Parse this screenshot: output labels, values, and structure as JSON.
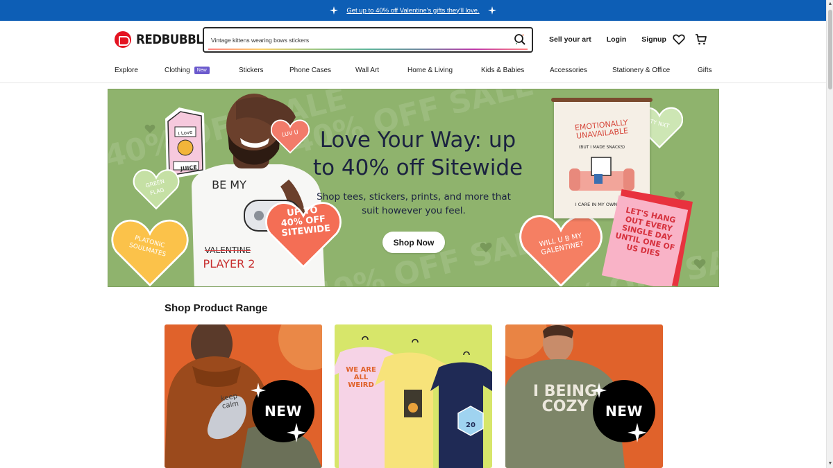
{
  "promo": {
    "text": "Get up to 40% off Valentine's gifts they'll love."
  },
  "header": {
    "brand": "REDBUBBLE",
    "search_value": "Vintage kittens wearing bows stickers",
    "links": [
      "Sell your art",
      "Login",
      "Signup"
    ],
    "icons": [
      "search-icon",
      "heart-icon",
      "cart-icon"
    ]
  },
  "nav": {
    "items": [
      "Explore",
      "Clothing",
      "Stickers",
      "Phone Cases",
      "Wall Art",
      "Home & Living",
      "Kids & Babies",
      "Accessories",
      "Stationery & Office",
      "Gifts"
    ],
    "clothing_badge": "New"
  },
  "hero": {
    "headline": "Love Your Way: up to 40% off Sitewide",
    "subtext": "Shop tees, stickers, prints, and more that suit however you feel.",
    "cta": "Shop Now",
    "background_color": "#8fb36d",
    "art": {
      "sale_text": "40% OFF SALE",
      "juice_label": "JUICE",
      "juice_top": "I Love",
      "shirt_text": "BE MY",
      "shirt_valentine": "VALENTINE",
      "shirt_player": "PLAYER 2",
      "heart_luv": "LUV U",
      "heart_green_flag": "GREEN FLAG",
      "heart_platonic": "PLATONIC SOULMATES",
      "heart_sale": "UP TO 40% OFF SITEWIDE",
      "heart_will": "WILL U B MY GALENTINE?",
      "heart_ty": "TY NXT",
      "poster_title": "EMOTIONALLY UNAVAILABLE",
      "poster_sub": "(BUT I MADE SNACKS)",
      "poster_footer": "I CARE IN MY OWN WAY",
      "card_text": "LET'S HANG OUT EVERY SINGLE DAY UNTIL ONE OF US DIES"
    }
  },
  "section": {
    "title": "Shop Product Range",
    "cards": [
      {
        "name": "hoodie",
        "art_text": "keep calm",
        "badge": "NEW",
        "bg": "#e0622b"
      },
      {
        "name": "tshirts",
        "art_text": "WE ARE ALL WEIRD",
        "dice": "20",
        "bg": "#d7e66a"
      },
      {
        "name": "sweatshirt",
        "art_text": "I BEING COZY",
        "badge": "NEW",
        "bg": "#e0622b"
      }
    ]
  }
}
